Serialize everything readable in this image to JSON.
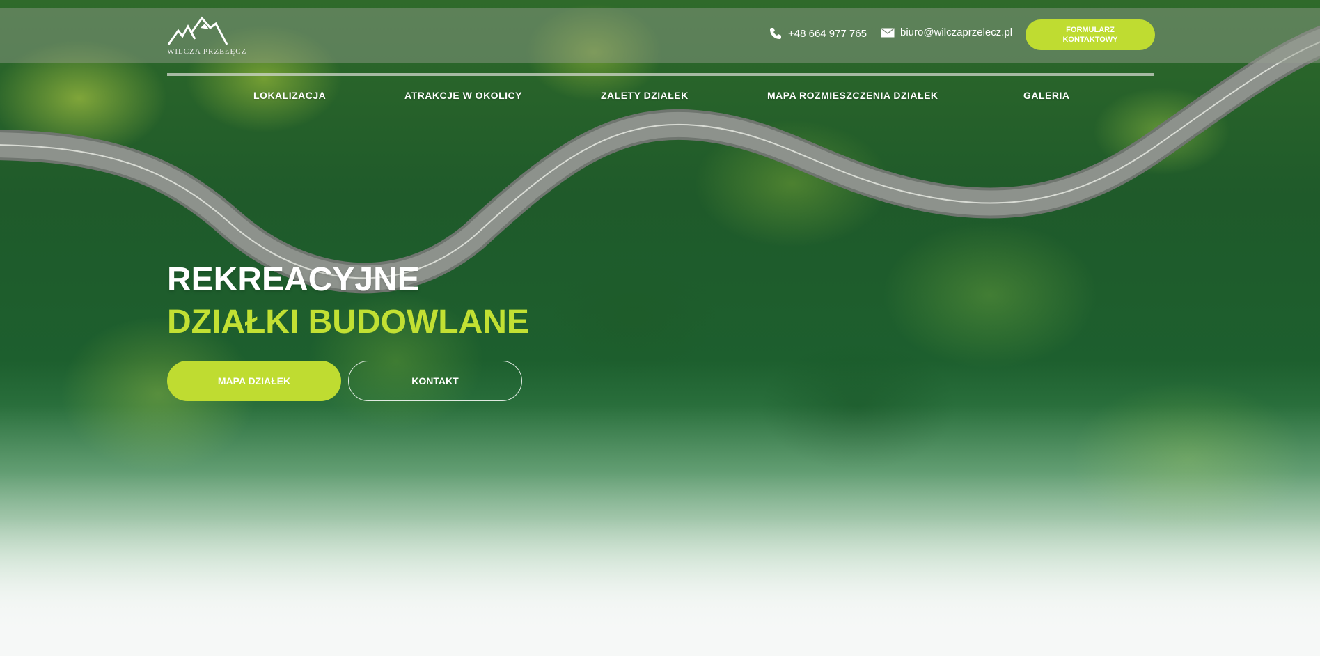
{
  "brand": {
    "logo_text": "WILCZA PRZEŁĘCZ"
  },
  "header": {
    "phone": "+48 664 977 765",
    "email": "biuro@wilczaprzelecz.pl",
    "form_button": "FORMULARZ KONTAKTOWY"
  },
  "nav": {
    "items": [
      {
        "label": "LOKALIZACJA"
      },
      {
        "label": "ATRAKCJE W OKOLICY"
      },
      {
        "label": "ZALETY DZIAŁEK"
      },
      {
        "label": "MAPA ROZMIESZCZENIA DZIAŁEK"
      },
      {
        "label": "GALERIA"
      }
    ]
  },
  "hero": {
    "title_line1": "REKREACYJNE",
    "title_line2": "DZIAŁKI BUDOWLANE",
    "primary_button": "MAPA DZIAŁEK",
    "secondary_button": "KONTAKT"
  },
  "colors": {
    "accent": "#bfdc31",
    "accent_text": "#c2e033",
    "forest_dark": "#1f5a2a"
  },
  "icons": {
    "phone": "phone-icon",
    "email": "envelope-icon",
    "logo": "wolf-mountain-logo"
  }
}
